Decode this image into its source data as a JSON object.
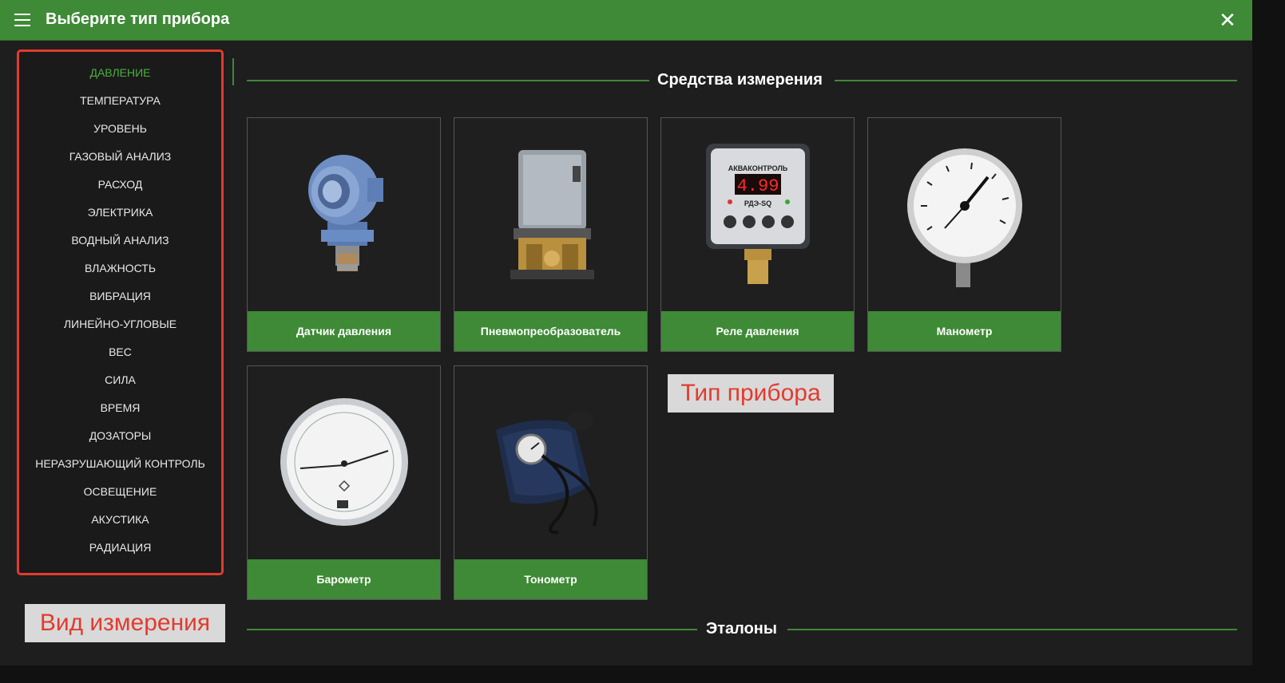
{
  "header": {
    "title": "Выберите тип прибора"
  },
  "sidebar": {
    "items": [
      {
        "label": "ДАВЛЕНИЕ",
        "active": true
      },
      {
        "label": "ТЕМПЕРАТУРА"
      },
      {
        "label": "УРОВЕНЬ"
      },
      {
        "label": "ГАЗОВЫЙ АНАЛИЗ"
      },
      {
        "label": "РАСХОД"
      },
      {
        "label": "ЭЛЕКТРИКА"
      },
      {
        "label": "ВОДНЫЙ АНАЛИЗ"
      },
      {
        "label": "ВЛАЖНОСТЬ"
      },
      {
        "label": "ВИБРАЦИЯ"
      },
      {
        "label": "ЛИНЕЙНО-УГЛОВЫЕ"
      },
      {
        "label": "ВЕС"
      },
      {
        "label": "СИЛА"
      },
      {
        "label": "ВРЕМЯ"
      },
      {
        "label": "ДОЗАТОРЫ"
      },
      {
        "label": "НЕРАЗРУШАЮЩИЙ КОНТРОЛЬ"
      },
      {
        "label": "ОСВЕЩЕНИЕ"
      },
      {
        "label": "АКУСТИКА"
      },
      {
        "label": "РАДИАЦИЯ"
      }
    ]
  },
  "sections": {
    "measuring_tools": "Средства измерения",
    "standards": "Эталоны"
  },
  "devices": [
    {
      "label": "Датчик давления",
      "icon": "pressure-transmitter-icon"
    },
    {
      "label": "Пневмопреобразователь",
      "icon": "pneumatic-converter-icon"
    },
    {
      "label": "Реле давления",
      "icon": "pressure-relay-icon",
      "display": "4.99",
      "brand": "АКВАКОНТРОЛЬ",
      "model": "РДЭ-SQ"
    },
    {
      "label": "Манометр",
      "icon": "manometer-icon"
    },
    {
      "label": "Барометр",
      "icon": "barometer-icon"
    },
    {
      "label": "Тонометр",
      "icon": "tonometer-icon"
    }
  ],
  "annotations": {
    "device_type": "Тип прибора",
    "measurement_kind": "Вид измерения"
  },
  "colors": {
    "accent": "#3e8a36",
    "highlight": "#e23b2f",
    "background": "#1e1e1e"
  }
}
